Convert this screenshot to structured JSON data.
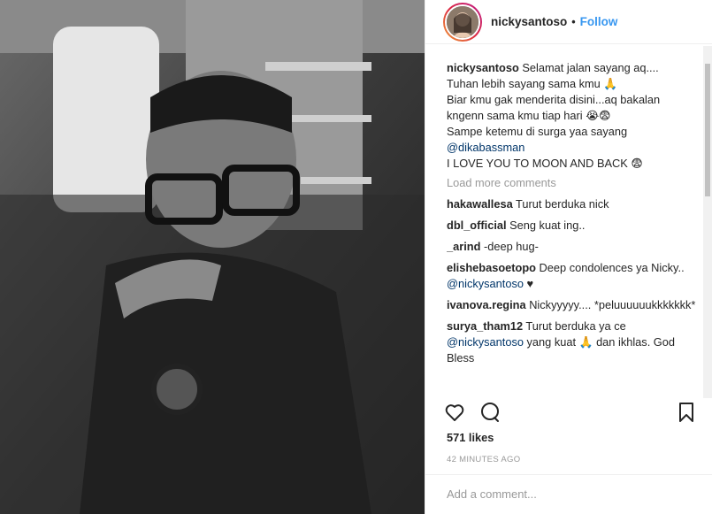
{
  "post": {
    "username": "nickysantoso",
    "separator": "•",
    "follow_label": "Follow"
  },
  "caption": {
    "username": "nickysantoso",
    "line1": "Selamat jalan sayang aq....",
    "line2": "Tuhan lebih sayang sama kmu 🙏",
    "line3": "Biar kmu gak menderita disini...aq bakalan kngenn sama kmu tiap hari 😭😨",
    "line4": "Sampe ketemu di surga yaa sayang",
    "mention": "@dikabassman",
    "line5": "I LOVE YOU TO MOON AND BACK 😨"
  },
  "load_more_label": "Load more comments",
  "comments": [
    {
      "user": "hakawallesa",
      "text": "Turut berduka nick"
    },
    {
      "user": "dbl_official",
      "text": "Seng kuat ing.."
    },
    {
      "user": "_arind",
      "text": "-deep hug-"
    },
    {
      "user": "elishebasoetopo",
      "text": "Deep condolences ya Nicky..",
      "mention": "@nickysantoso",
      "after": "♥"
    },
    {
      "user": "ivanova.regina",
      "text": "Nickyyyyy.... *peluuuuuukkkkkkk*"
    },
    {
      "user": "surya_tham12",
      "text": "Turut berduka ya ce",
      "mention": "@nickysantoso",
      "after": "yang kuat 🙏 dan ikhlas. God Bless"
    }
  ],
  "icons": {
    "like": "heart-icon",
    "comment": "comment-bubble-icon",
    "save": "bookmark-icon"
  },
  "likes_label": "571 likes",
  "timestamp": "42 MINUTES AGO",
  "add_comment_placeholder": "Add a comment..."
}
